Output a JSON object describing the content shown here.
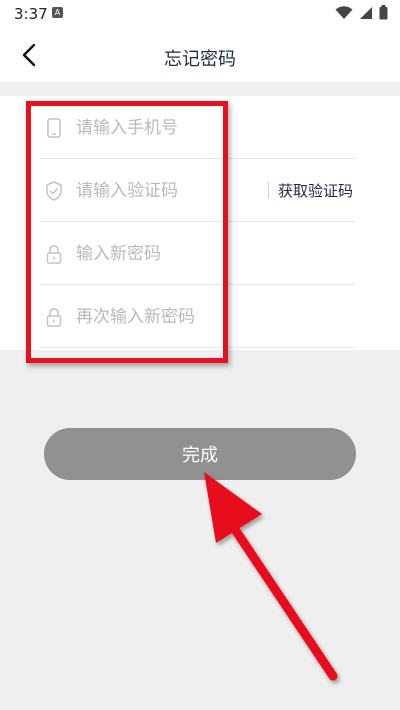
{
  "status_bar": {
    "time": "3:37",
    "notification_icon": "A",
    "icons": [
      "wifi-icon",
      "signal-icon",
      "battery-icon"
    ]
  },
  "header": {
    "title": "忘记密码",
    "back_icon": "chevron-left-icon"
  },
  "form": {
    "phone": {
      "placeholder": "请输入手机号",
      "icon": "phone-icon"
    },
    "code": {
      "placeholder": "请输入验证码",
      "icon": "shield-icon",
      "get_code_label": "获取验证码"
    },
    "new_password": {
      "placeholder": "输入新密码",
      "icon": "lock-icon"
    },
    "confirm_password": {
      "placeholder": "再次输入新密码",
      "icon": "lock-icon"
    }
  },
  "submit": {
    "label": "完成"
  },
  "colors": {
    "accent": "#1f2a44",
    "highlight": "#e8101c",
    "button": "#919191"
  }
}
